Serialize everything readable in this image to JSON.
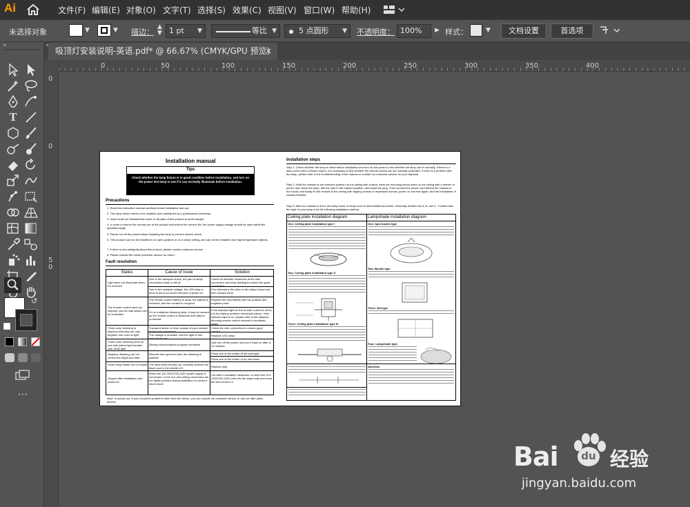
{
  "app": {
    "logo": "Ai"
  },
  "menu": [
    "文件(F)",
    "编辑(E)",
    "对象(O)",
    "文字(T)",
    "选择(S)",
    "效果(C)",
    "视图(V)",
    "窗口(W)",
    "帮助(H)"
  ],
  "control_bar": {
    "selection": "未选择对象",
    "stroke_label": "描边：",
    "stroke_value": "1 pt",
    "line_style": "等比",
    "brush": "5 点圆形",
    "opacity_label": "不透明度：",
    "opacity_value": "100%",
    "style_label": "样式：",
    "doc_settings": "文档设置",
    "preferences": "首选项"
  },
  "document_tab": {
    "title": "吸顶灯安装说明-英语.pdf* @ 66.67% (CMYK/GPU 预览)",
    "close": "×"
  },
  "ruler": {
    "h_labels": [
      "0",
      "50",
      "100",
      "150",
      "200",
      "250",
      "300",
      "350",
      "400"
    ],
    "v_labels": [
      "0",
      "5",
      "0"
    ]
  },
  "manual": {
    "title": "Installation manual",
    "tips_title": "Tips",
    "tips_text": "Check whether the lamp fixture is in good condition before installation, and turn on the power test lamp to see if it can normally illuminate before installation.",
    "precautions_title": "Precautions",
    "precautions": [
      "1. Read this instruction manual carefully before installation and use.",
      "2. This lamp fixture needs to be installed and maintained by a professional electrician.",
      "3. Users must not disassemble some or all parts of this product to avoid danger.",
      "4. In order to ensure the normal use of the product and extend the service life, the power supply voltage should be used within the specified range",
      "5. Please cut off the power before installing the lamp to prevent electric shock.",
      "6. This product can not be installed in an open position or on a damp ceiling, and can not be installed near high temperature objects.",
      "7. If there is any ambiguity about this product, please contact customer service.",
      "8. Please contact the online customer service for return."
    ],
    "fault_title": "Fault resolution",
    "fault_headers": [
      "Status",
      "Cause of Issue",
      "Solution"
    ],
    "fault_rows": [
      [
        "Light does not illuminate when it's received",
        "Due to the transport shock, the part of strips connection loose or fell of.",
        "Check for whether looseness at the wire connection and drop welding to ensure the good connection"
      ],
      [
        "",
        "Due to the unstable voltage, the LED strip or drive is burnt out at the moment of power-on",
        "First determine the drive or the strips burned out then replace them"
      ],
      [
        "The remote control does not respond, but the wall switch can be controlled",
        "The remote control battery is dead, the battery is reversed, and the contact is not good.",
        "Replace the new battery with the positive and negative poles"
      ],
      [
        "",
        "If it is a stepless dimming lamp, it may be caused by the remote control is disturbed and without proofread.",
        "If the indicator light on the remote control is not lit, it is the battery problem mentioned above. If the indicator light is on, please refer to the stepless dimming remote control manual to proofread again."
      ],
      [
        "Three-color dimming or stepless dimming can only brighten one color of light",
        "Transport shock or other causes of poor contact at the wire connection",
        "Check the wire connection to ensure good contact."
      ],
      [
        "",
        "The voltage is unstable, and the light of one color burns out.",
        "Replace LED strips"
      ],
      [
        "Three-color dimming turns on, one side yellow light another side white light",
        "Driving microcomputer program confusion",
        "Just turn off the power and turn it back on after 5-10 minutes."
      ],
      [
        "Stepless dimming can not control the bright and dark",
        "Remote click speed is slow, the dimming is suitable",
        "Press one of the button of left and right"
      ],
      [
        "",
        "",
        "Press one of the button of up and down"
      ],
      [
        "Some lamp beads are not bright",
        "The lamp bead burned out, carefully observe the black spot in the middle of it",
        "Replace strip"
      ],
      [
        "Tripped after installation and power-on",
        "When the 110-130V/220-240V power supply is connected, or the box and ceiling connectors are too tightly pressed during installation to cause a short circuit.",
        "Cut wall in insulation measures, or insert the 110-130V/220-240V wire into the lamp body and move the wire head to it"
      ]
    ],
    "note": "Note: In actual use, if you encounter problems other than the above, you can consult our customer service or call our after-sales service.",
    "steps_title": "Installation steps",
    "steps": [
      "Step 1: Check whether the lamp is intact before installation and turn on the power to test whether the lamp can lit normally. If there is a lamp come with a remote control, it is necessary to test whether the remote control can be normally controlled. If there is a problem with the lamp, please refer to the troubleshooting of the manual or contact our customer service for your disposal.",
      "Step 2: Hold the chassis in the reserved position on the ceiling with a hand, mark the mounting screw holes on the ceiling with a marker or pencil, then lower the lamp, drill the hole in the marked position, and insert the plug. Then connect the power cord behind the chassis to the circuit, and finally fix the chassis to the ceiling with tapping screws or expansion screws, power on and test again, and the installation of chassis finished.",
      "Step 3: After the chassis is fixed, the lamp frame or lamp cover is last installed and fixed. Generally divided into A, B, and C. Confirm that the style of your lamp is by the following installation method."
    ],
    "ceiling_title": "Ceiling plate installation diagram",
    "ceiling_sub": [
      "One: Ceiling plate installation type I",
      "Two: Ceiling plate installation type II",
      "Three: Ceiling plate installation type III"
    ],
    "lampshade_title": "Lampshade installation diagram",
    "lampshade_sub": [
      "One: Spin buckle type",
      "Two: Buckle type",
      "Three: Nut type",
      "Four: Lampshade type"
    ],
    "attention_title": "Attention"
  },
  "watermark": {
    "text": "Bai",
    "paw": "du",
    "cn": "经验",
    "url": "jingyan.baidu.com"
  },
  "colors": {
    "app_bg": "#535353",
    "menubar": "#323232",
    "logo": "#ff9a00",
    "artboard": "#ffffff"
  }
}
